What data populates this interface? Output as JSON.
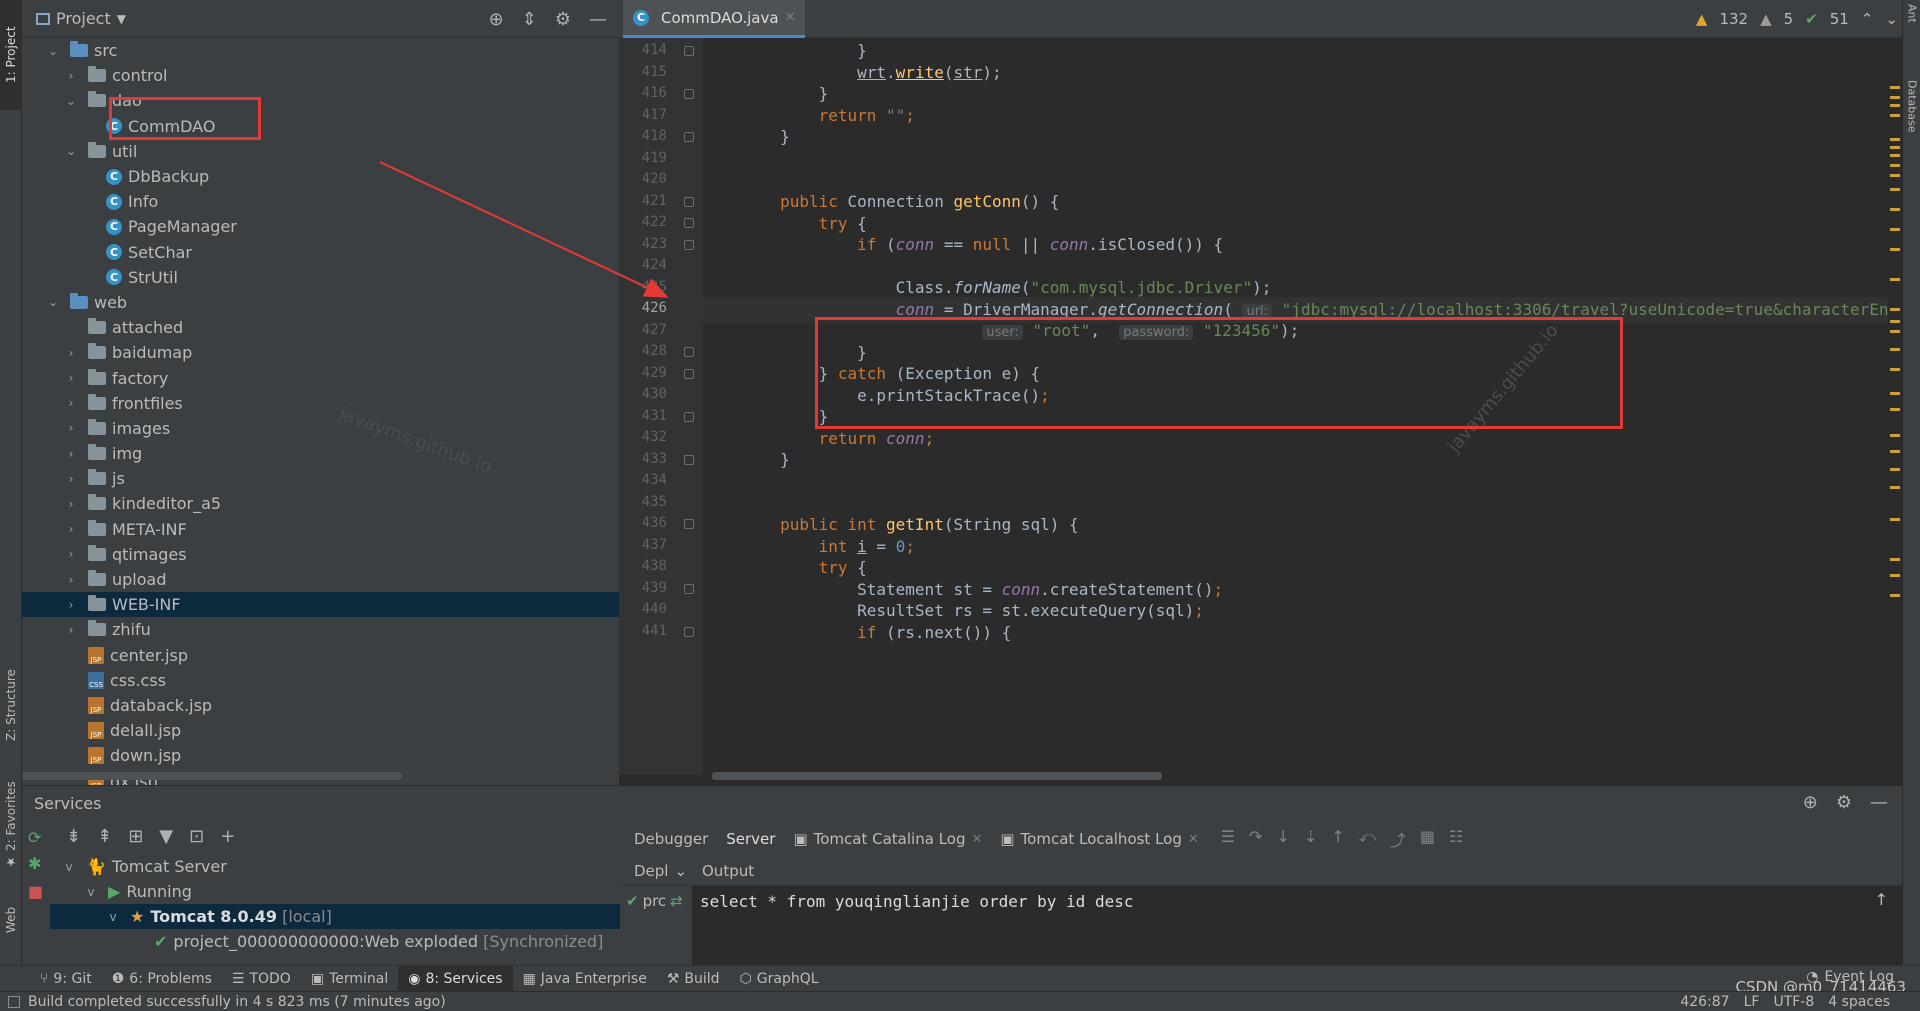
{
  "left_strip": {
    "project_tab": "1: Project",
    "structure_tab": "Z: Structure",
    "favorites_tab": "2: Favorites",
    "web_tab": "Web"
  },
  "right_strip": {
    "ant_tab": "Ant",
    "database_tab": "Database"
  },
  "project_panel": {
    "title": "Project",
    "tree": [
      {
        "label": "src",
        "indent": 0,
        "chev": "v",
        "icon": "folder-blue"
      },
      {
        "label": "control",
        "indent": 1,
        "chev": ">",
        "icon": "package"
      },
      {
        "label": "dao",
        "indent": 1,
        "chev": "v",
        "icon": "package"
      },
      {
        "label": "CommDAO",
        "indent": 2,
        "chev": "",
        "icon": "class"
      },
      {
        "label": "util",
        "indent": 1,
        "chev": "v",
        "icon": "package"
      },
      {
        "label": "DbBackup",
        "indent": 2,
        "chev": "",
        "icon": "class"
      },
      {
        "label": "Info",
        "indent": 2,
        "chev": "",
        "icon": "class"
      },
      {
        "label": "PageManager",
        "indent": 2,
        "chev": "",
        "icon": "class"
      },
      {
        "label": "SetChar",
        "indent": 2,
        "chev": "",
        "icon": "class"
      },
      {
        "label": "StrUtil",
        "indent": 2,
        "chev": "",
        "icon": "class"
      },
      {
        "label": "web",
        "indent": 0,
        "chev": "v",
        "icon": "folder-blue"
      },
      {
        "label": "attached",
        "indent": 1,
        "chev": "",
        "icon": "folder"
      },
      {
        "label": "baidumap",
        "indent": 1,
        "chev": ">",
        "icon": "folder"
      },
      {
        "label": "factory",
        "indent": 1,
        "chev": ">",
        "icon": "folder"
      },
      {
        "label": "frontfiles",
        "indent": 1,
        "chev": ">",
        "icon": "folder"
      },
      {
        "label": "images",
        "indent": 1,
        "chev": ">",
        "icon": "folder"
      },
      {
        "label": "img",
        "indent": 1,
        "chev": ">",
        "icon": "folder"
      },
      {
        "label": "js",
        "indent": 1,
        "chev": ">",
        "icon": "folder"
      },
      {
        "label": "kindeditor_a5",
        "indent": 1,
        "chev": ">",
        "icon": "folder"
      },
      {
        "label": "META-INF",
        "indent": 1,
        "chev": ">",
        "icon": "folder"
      },
      {
        "label": "qtimages",
        "indent": 1,
        "chev": ">",
        "icon": "folder"
      },
      {
        "label": "upload",
        "indent": 1,
        "chev": ">",
        "icon": "folder"
      },
      {
        "label": "WEB-INF",
        "indent": 1,
        "chev": ">",
        "icon": "folder",
        "selected": true
      },
      {
        "label": "zhifu",
        "indent": 1,
        "chev": ">",
        "icon": "folder"
      },
      {
        "label": "center.jsp",
        "indent": 1,
        "chev": "",
        "icon": "jsp"
      },
      {
        "label": "css.css",
        "indent": 1,
        "chev": "",
        "icon": "css"
      },
      {
        "label": "databack.jsp",
        "indent": 1,
        "chev": "",
        "icon": "jsp"
      },
      {
        "label": "delall.jsp",
        "indent": 1,
        "chev": "",
        "icon": "jsp"
      },
      {
        "label": "down.jsp",
        "indent": 1,
        "chev": "",
        "icon": "jsp"
      },
      {
        "label": "dx.jsp",
        "indent": 1,
        "chev": "",
        "icon": "jsp"
      }
    ]
  },
  "editor": {
    "tab_label": "CommDAO.java",
    "inspection": {
      "warnings": "132",
      "weak_warnings": "5",
      "typos": "51"
    },
    "line_numbers": [
      "414",
      "415",
      "416",
      "417",
      "418",
      "419",
      "420",
      "421",
      "422",
      "423",
      "424",
      "425",
      "426",
      "427",
      "428",
      "429",
      "430",
      "431",
      "432",
      "433",
      "434",
      "435",
      "436",
      "437",
      "438",
      "439",
      "440",
      "441"
    ],
    "current_line": "426"
  },
  "services": {
    "title": "Services",
    "tree": {
      "server": "Tomcat Server",
      "state": "Running",
      "instance": "Tomcat 8.0.49",
      "instance_tag": "[local]",
      "artifact": "project_000000000000:Web exploded",
      "artifact_tag": "[Synchronized]"
    },
    "tabs": [
      "Debugger",
      "Server",
      "Tomcat Catalina Log",
      "Tomcat Localhost Log"
    ],
    "deploy_label": "Depl",
    "output_label": "Output",
    "deploy_item": "prc",
    "output_line": "select * from youqinglianjie order by id desc"
  },
  "bottom_tools": [
    {
      "label": "9: Git",
      "icon": "git-icon"
    },
    {
      "label": "6: Problems",
      "icon": "problems-icon"
    },
    {
      "label": "TODO",
      "icon": "todo-icon"
    },
    {
      "label": "Terminal",
      "icon": "terminal-icon"
    },
    {
      "label": "8: Services",
      "icon": "services-icon",
      "active": true
    },
    {
      "label": "Java Enterprise",
      "icon": "java-enterprise-icon"
    },
    {
      "label": "Build",
      "icon": "build-icon"
    },
    {
      "label": "GraphQL",
      "icon": "graphql-icon"
    }
  ],
  "event_log": "Event Log",
  "status": {
    "message": "Build completed successfully in 4 s 823 ms (7 minutes ago)",
    "position": "426:87",
    "line_sep": "LF",
    "encoding": "UTF-8",
    "indent": "4 spaces"
  },
  "watermarks": {
    "csdn": "CSDN @m0_71414463",
    "site": "javayms.github.io"
  },
  "colors": {
    "accent": "#4a88c7",
    "annotation_red": "#e53935",
    "keyword": "#cc7832",
    "string": "#6a8759"
  }
}
